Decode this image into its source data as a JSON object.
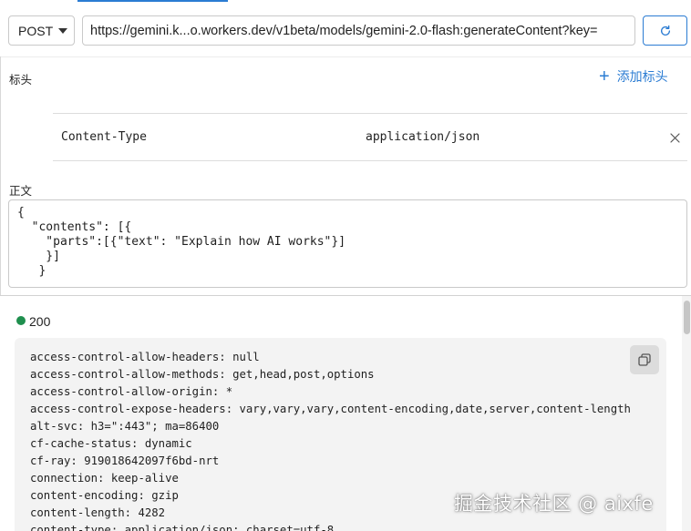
{
  "request": {
    "method": "POST",
    "url": "https://gemini.k...o.workers.dev/v1beta/models/gemini-2.0-flash:generateContent?key="
  },
  "headers_section": {
    "label": "标头",
    "add_label": "添加标头",
    "rows": [
      {
        "key": "Content-Type",
        "value": "application/json"
      }
    ]
  },
  "body_section": {
    "label": "正文",
    "content": "{\n  \"contents\": [{\n    \"parts\":[{\"text\": \"Explain how AI works\"}]\n    }]\n   }"
  },
  "response": {
    "status": "200",
    "status_color": "#1f8f4e",
    "headers": [
      "access-control-allow-headers: null",
      "access-control-allow-methods: get,head,post,options",
      "access-control-allow-origin: *",
      "access-control-expose-headers: vary,vary,vary,content-encoding,date,server,content-length",
      "alt-svc: h3=\":443\"; ma=86400",
      "cf-cache-status: dynamic",
      "cf-ray: 919018642097f6bd-nrt",
      "connection: keep-alive",
      "content-encoding: gzip",
      "content-length: 4282",
      "content-type: application/json; charset=utf-8"
    ]
  },
  "watermark": "掘金技术社区 @ aixfe",
  "colors": {
    "accent": "#2b7cd3",
    "response_bg": "#f3f3f3"
  },
  "icons": {
    "refresh": "refresh-icon",
    "plus": "plus-icon",
    "remove": "close-icon",
    "copy": "copy-icon",
    "method_caret": "caret-down-icon"
  }
}
